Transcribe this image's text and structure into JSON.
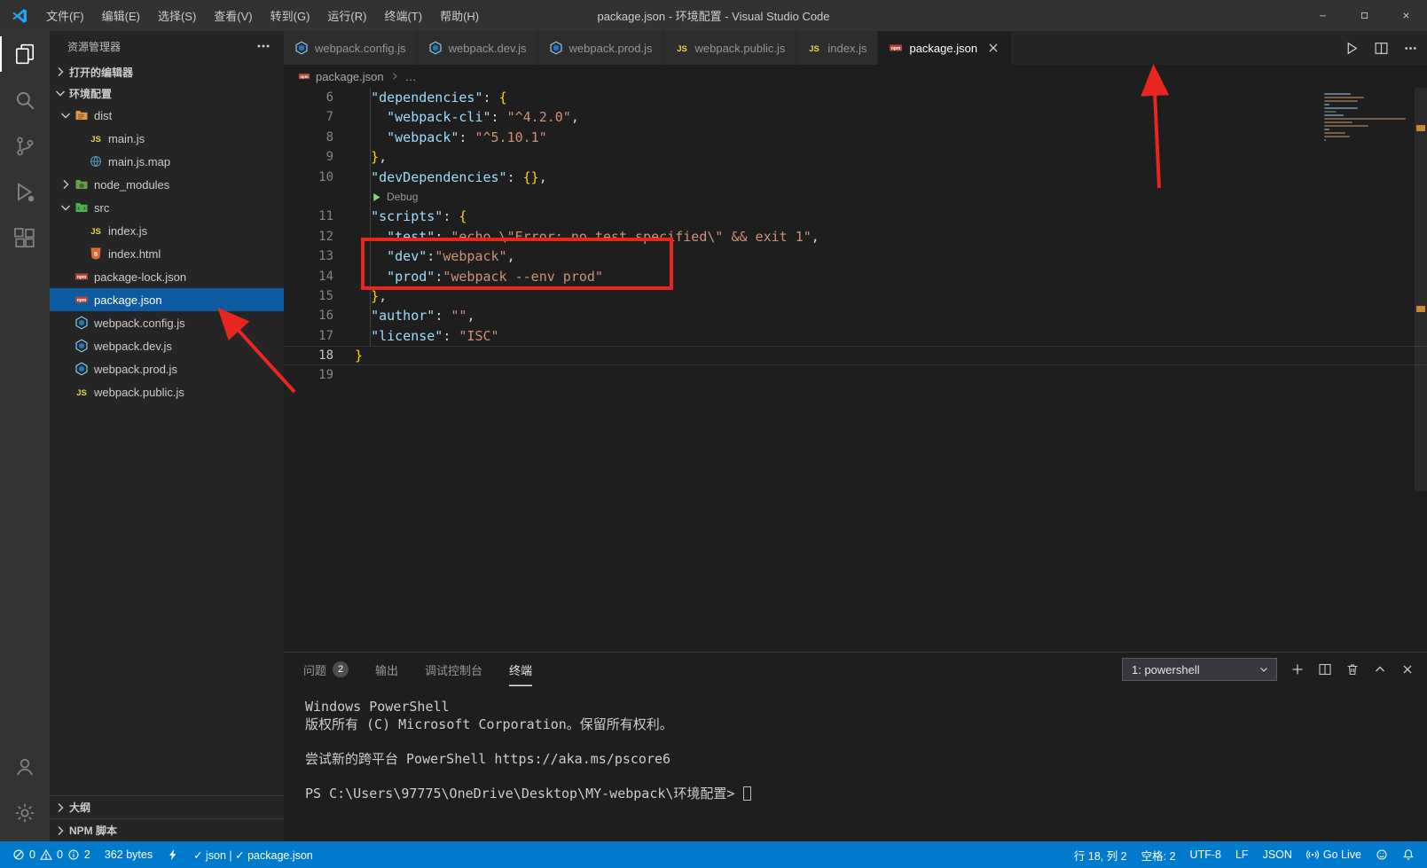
{
  "title_bar": {
    "menus": [
      "文件(F)",
      "编辑(E)",
      "选择(S)",
      "查看(V)",
      "转到(G)",
      "运行(R)",
      "终端(T)",
      "帮助(H)"
    ],
    "title": "package.json - 环境配置 - Visual Studio Code"
  },
  "sidebar": {
    "title": "资源管理器",
    "open_editors": "打开的编辑器",
    "root": "环境配置",
    "tree": [
      {
        "label": "dist",
        "icon": "folder-dist-icon",
        "chevron": "down",
        "depth": 0
      },
      {
        "label": "main.js",
        "icon": "js-icon",
        "depth": 1
      },
      {
        "label": "main.js.map",
        "icon": "map-icon",
        "depth": 1
      },
      {
        "label": "node_modules",
        "icon": "folder-node-icon",
        "chevron": "right",
        "depth": 0
      },
      {
        "label": "src",
        "icon": "folder-src-icon",
        "chevron": "down",
        "depth": 0
      },
      {
        "label": "index.js",
        "icon": "js-icon",
        "depth": 1
      },
      {
        "label": "index.html",
        "icon": "html-icon",
        "depth": 1
      },
      {
        "label": "package-lock.json",
        "icon": "npm-icon",
        "depth": 0
      },
      {
        "label": "package.json",
        "icon": "npm-icon",
        "depth": 0,
        "selected": true
      },
      {
        "label": "webpack.config.js",
        "icon": "webpack-icon",
        "depth": 0
      },
      {
        "label": "webpack.dev.js",
        "icon": "webpack-icon",
        "depth": 0
      },
      {
        "label": "webpack.prod.js",
        "icon": "webpack-icon",
        "depth": 0
      },
      {
        "label": "webpack.public.js",
        "icon": "js-icon",
        "depth": 0
      }
    ],
    "bottom_sections": [
      "大纲",
      "NPM 脚本"
    ]
  },
  "tabs": [
    {
      "label": "webpack.config.js",
      "icon": "webpack-icon"
    },
    {
      "label": "webpack.dev.js",
      "icon": "webpack-icon"
    },
    {
      "label": "webpack.prod.js",
      "icon": "webpack-icon"
    },
    {
      "label": "webpack.public.js",
      "icon": "js-icon"
    },
    {
      "label": "index.js",
      "icon": "js-icon"
    },
    {
      "label": "package.json",
      "icon": "npm-icon",
      "active": true
    }
  ],
  "breadcrumb": {
    "file": "package.json",
    "more": "…"
  },
  "editor": {
    "code_lines": [
      {
        "num": "6",
        "tokens": [
          [
            "pn",
            "  "
          ],
          [
            "ky",
            "\"dependencies\""
          ],
          [
            "pn",
            ": "
          ],
          [
            "br",
            "{"
          ]
        ]
      },
      {
        "num": "7",
        "tokens": [
          [
            "pn",
            "    "
          ],
          [
            "ky",
            "\"webpack-cli\""
          ],
          [
            "pn",
            ": "
          ],
          [
            "st",
            "\"^4.2.0\""
          ],
          [
            "pn",
            ","
          ]
        ]
      },
      {
        "num": "8",
        "tokens": [
          [
            "pn",
            "    "
          ],
          [
            "ky",
            "\"webpack\""
          ],
          [
            "pn",
            ": "
          ],
          [
            "st",
            "\"^5.10.1\""
          ]
        ]
      },
      {
        "num": "9",
        "tokens": [
          [
            "pn",
            "  "
          ],
          [
            "br",
            "}"
          ],
          [
            "pn",
            ","
          ]
        ]
      },
      {
        "num": "10",
        "tokens": [
          [
            "pn",
            "  "
          ],
          [
            "ky",
            "\"devDependencies\""
          ],
          [
            "pn",
            ": "
          ],
          [
            "br",
            "{}"
          ],
          [
            "pn",
            ","
          ]
        ]
      },
      {
        "codelens": "Debug"
      },
      {
        "num": "11",
        "tokens": [
          [
            "pn",
            "  "
          ],
          [
            "ky",
            "\"scripts\""
          ],
          [
            "pn",
            ": "
          ],
          [
            "br",
            "{"
          ]
        ]
      },
      {
        "num": "12",
        "tokens": [
          [
            "pn",
            "    "
          ],
          [
            "ky",
            "\"test\""
          ],
          [
            "pn",
            ": "
          ],
          [
            "st",
            "\"echo \\\"Error: no test specified\\\" && exit 1\""
          ],
          [
            "pn",
            ","
          ]
        ]
      },
      {
        "num": "13",
        "boxed": true,
        "tokens": [
          [
            "pn",
            "    "
          ],
          [
            "ky",
            "\"dev\""
          ],
          [
            "pn",
            ":"
          ],
          [
            "st",
            "\"webpack\""
          ],
          [
            "pn",
            ","
          ]
        ]
      },
      {
        "num": "14",
        "boxed": true,
        "tokens": [
          [
            "pn",
            "    "
          ],
          [
            "ky",
            "\"prod\""
          ],
          [
            "pn",
            ":"
          ],
          [
            "st",
            "\"webpack --env prod\""
          ]
        ]
      },
      {
        "num": "15",
        "tokens": [
          [
            "pn",
            "  "
          ],
          [
            "br",
            "}"
          ],
          [
            "pn",
            ","
          ]
        ]
      },
      {
        "num": "16",
        "tokens": [
          [
            "pn",
            "  "
          ],
          [
            "ky",
            "\"author\""
          ],
          [
            "pn",
            ": "
          ],
          [
            "st",
            "\"\""
          ],
          [
            "pn",
            ","
          ]
        ]
      },
      {
        "num": "17",
        "tokens": [
          [
            "pn",
            "  "
          ],
          [
            "ky",
            "\"license\""
          ],
          [
            "pn",
            ": "
          ],
          [
            "st",
            "\"ISC\""
          ]
        ]
      },
      {
        "num": "18",
        "current": true,
        "tokens": [
          [
            "br",
            "}"
          ]
        ]
      },
      {
        "num": "19",
        "tokens": []
      }
    ]
  },
  "panel": {
    "tabs": [
      {
        "label": "问题",
        "badge": "2"
      },
      {
        "label": "输出"
      },
      {
        "label": "调试控制台"
      },
      {
        "label": "终端",
        "active": true
      }
    ],
    "terminal_picker": "1: powershell",
    "terminal_lines": [
      "Windows PowerShell",
      "版权所有 (C) Microsoft Corporation。保留所有权利。",
      "",
      "尝试新的跨平台 PowerShell https://aka.ms/pscore6",
      "",
      "PS C:\\Users\\97775\\OneDrive\\Desktop\\MY-webpack\\环境配置> "
    ]
  },
  "status_bar": {
    "errors": "0",
    "warnings": "0",
    "infos": "2",
    "file_size": "362 bytes",
    "lint": "✓ json  |  ✓ package.json",
    "cursor": "行 18, 列 2",
    "indent": "空格: 2",
    "encoding": "UTF-8",
    "eol": "LF",
    "language": "JSON",
    "go_live": "Go Live"
  },
  "annotations": {
    "color": "#e8261f"
  }
}
